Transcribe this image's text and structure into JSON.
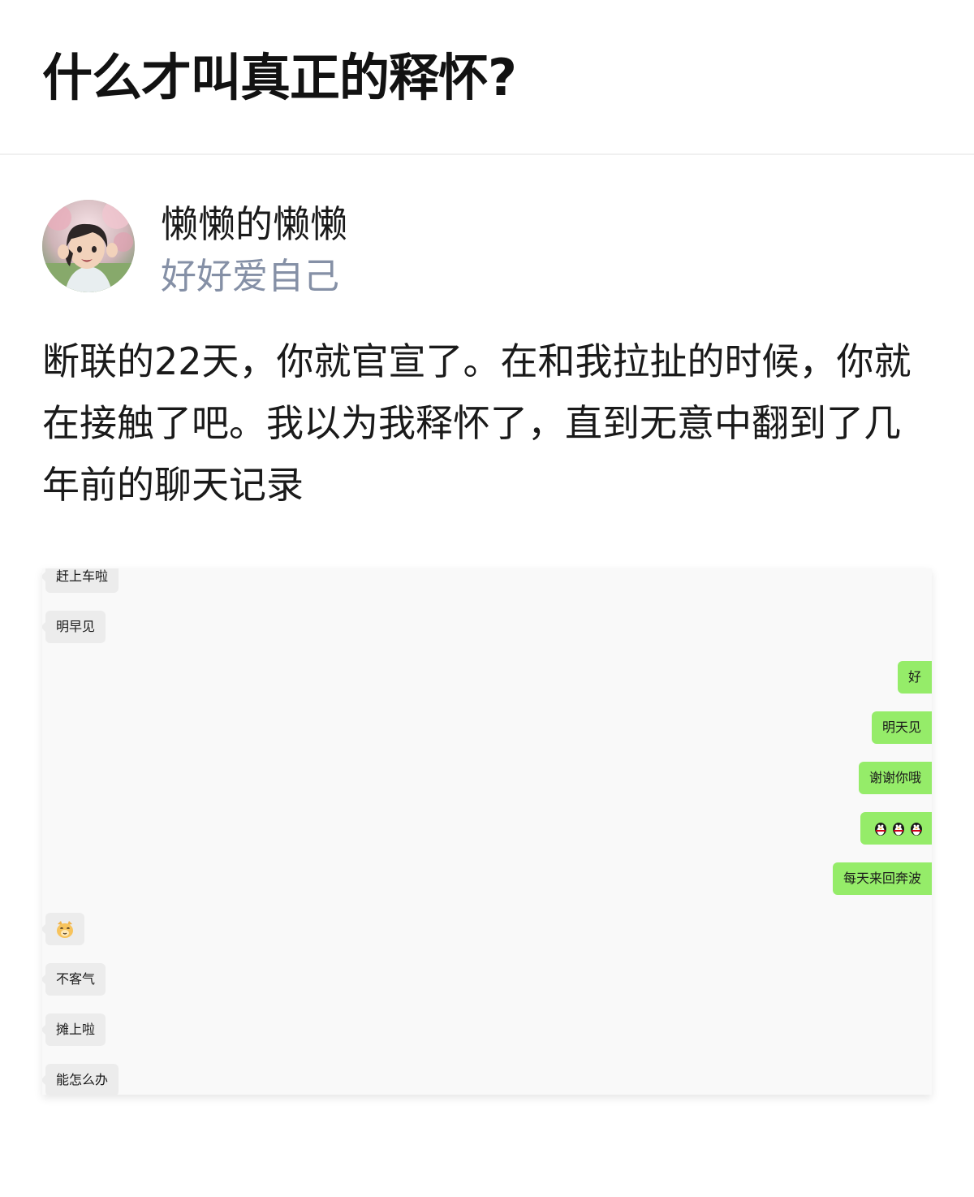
{
  "question": {
    "title": "什么才叫真正的释怀?"
  },
  "author": {
    "name": "懒懒的懒懒",
    "bio": "好好爱自己"
  },
  "answer": {
    "text": "断联的22天，你就官宣了。在和我拉扯的时候，你就在接触了吧。我以为我释怀了，直到无意中翻到了几年前的聊天记录"
  },
  "chat": {
    "messages": [
      {
        "side": "left",
        "text": "赶上车啦"
      },
      {
        "side": "left",
        "text": "明早见"
      },
      {
        "side": "right",
        "text": "好"
      },
      {
        "side": "right",
        "text": "明天见"
      },
      {
        "side": "right",
        "text": "谢谢你哦"
      },
      {
        "side": "right",
        "emoji": "penguin-emoji x3"
      },
      {
        "side": "right",
        "text": "每天来回奔波"
      },
      {
        "side": "left",
        "emoji": "cat-face-emoji",
        "text": "🐱"
      },
      {
        "side": "left",
        "text": "不客气"
      },
      {
        "side": "left",
        "text": "摊上啦"
      },
      {
        "side": "left",
        "text": "能怎么办"
      }
    ]
  },
  "colors": {
    "bio": "#8590a6",
    "bubble_left": "#ececec",
    "bubble_right": "#95ec69",
    "chat_background": "#f9f9f9"
  }
}
